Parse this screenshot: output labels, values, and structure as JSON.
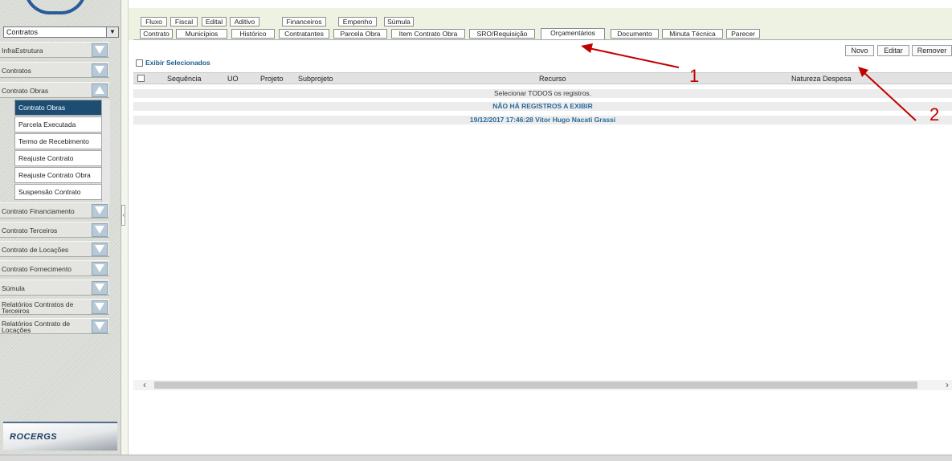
{
  "sidebar": {
    "module_select": "Contratos",
    "menus": [
      {
        "label": "InfraEstrutura",
        "state": "collapsed"
      },
      {
        "label": "Contratos",
        "state": "collapsed"
      },
      {
        "label": "Contrato Obras",
        "state": "expanded"
      }
    ],
    "submenu": [
      {
        "label": "Contrato Obras",
        "active": true
      },
      {
        "label": "Parcela Executada",
        "active": false
      },
      {
        "label": "Termo de Recebimento",
        "active": false
      },
      {
        "label": "Reajuste Contrato",
        "active": false
      },
      {
        "label": "Reajuste Contrato Obra",
        "active": false
      },
      {
        "label": "Suspensão Contrato",
        "active": false
      }
    ],
    "menus_after": [
      {
        "label": "Contrato Financiamento"
      },
      {
        "label": "Contrato Terceiros"
      },
      {
        "label": "Contrato de Locações"
      },
      {
        "label": "Contrato Fornecimento"
      },
      {
        "label": "Súmula"
      },
      {
        "label": "Relatórios Contratos de Terceiros"
      },
      {
        "label": "Relatórios Contrato de Locações"
      }
    ],
    "logo_text": "ROCERGS"
  },
  "tabs_row1": [
    "Fluxo",
    "Fiscal",
    "Edital",
    "Aditivo",
    "Financeiros",
    "Empenho",
    "Súmula"
  ],
  "tabs_row2": [
    "Contrato",
    "Municípios",
    "Histórico",
    "Contratantes",
    "Parcela Obra",
    "Item Contrato Obra",
    "SRO/Requisição",
    "Orçamentários",
    "Documento",
    "Minuta Técnica",
    "Parecer"
  ],
  "selected_tab": "Orçamentários",
  "toolbar": {
    "new_label": "Novo",
    "edit_label": "Editar",
    "remove_label": "Remover"
  },
  "exibir_label": "Exibir Selecionados",
  "grid": {
    "columns": [
      "Sequência",
      "UO",
      "Projeto",
      "Subprojeto",
      "Recurso",
      "Natureza Despesa"
    ],
    "select_all_text": "Selecionar TODOS os registros.",
    "empty_text": "NÃO HÁ REGISTROS A EXIBIR",
    "timestamp_text": "19/12/2017 17:46:28  Vitor Hugo Nacati Grassi"
  },
  "annotations": {
    "label_1": "1",
    "label_2": "2",
    "color": "#c00000"
  },
  "colors": {
    "active_menu": "#1e4d73",
    "tab_area_bg": "#eef2e2",
    "link_blue": "#2a6a9a"
  }
}
